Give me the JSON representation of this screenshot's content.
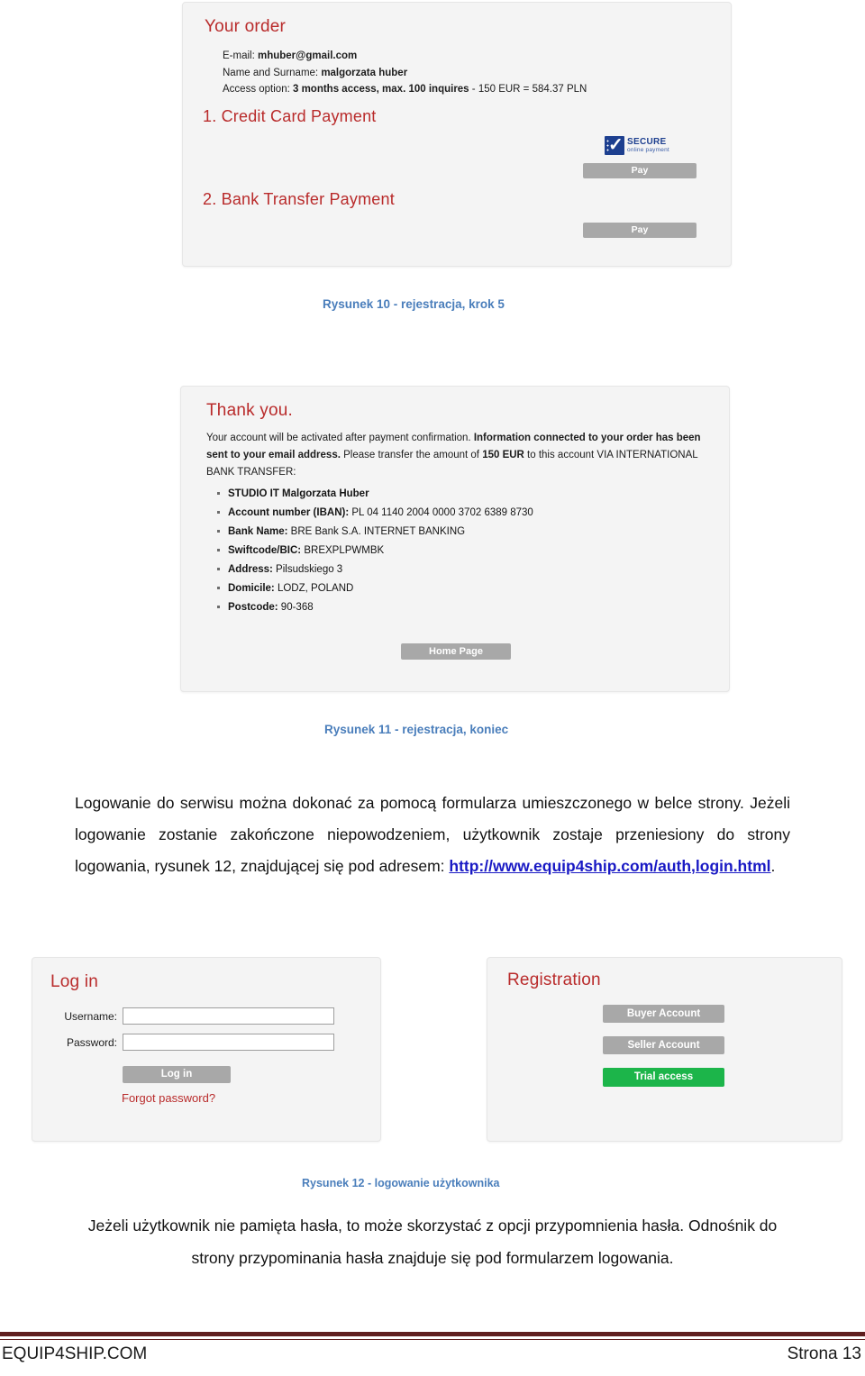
{
  "figure_order": {
    "title": "Your order",
    "details": [
      {
        "label": "E-mail: ",
        "value": "mhuber@gmail.com"
      },
      {
        "label": "Name and Surname: ",
        "value": "malgorzata huber"
      },
      {
        "label": "Access option: ",
        "value": "3 months access, max. 100 inquires",
        "suffix": " - 150 EUR = 584.37 PLN"
      }
    ],
    "credit_card_heading": "1. Credit Card Payment",
    "bank_transfer_heading": "2. Bank Transfer Payment",
    "secure_badge": {
      "line1": "SECURE",
      "line2": "online payment",
      "icon": "secure-check-icon"
    },
    "pay_button_cc": "Pay",
    "pay_button_bt": "Pay"
  },
  "figure_thanks": {
    "title": "Thank you.",
    "body_part1": "Your account will be activated after payment confirmation. ",
    "body_bold1": "Information connected to your order has been sent to your email address.",
    "body_part2": " Please transfer the amount of ",
    "body_bold2": "150 EUR",
    "body_part3": " to this account VIA INTERNATIONAL BANK TRANSFER:",
    "bank_items": [
      {
        "label": "STUDIO IT Malgorzata Huber",
        "value": ""
      },
      {
        "label": "Account number (IBAN): ",
        "value": "PL 04 1140 2004 0000 3702 6389 8730"
      },
      {
        "label": "Bank Name: ",
        "value": "BRE Bank S.A. INTERNET BANKING"
      },
      {
        "label": "Swiftcode/BIC: ",
        "value": "BREXPLPWMBK"
      },
      {
        "label": "Address: ",
        "value": "Pilsudskiego 3"
      },
      {
        "label": "Domicile: ",
        "value": "LODZ, POLAND"
      },
      {
        "label": "Postcode: ",
        "value": "90-368"
      }
    ],
    "home_button": "Home Page"
  },
  "figure_login": {
    "login_title": "Log in",
    "username_label": "Username:",
    "username_value": "",
    "password_label": "Password:",
    "password_value": "",
    "login_button": "Log in",
    "forgot_link": "Forgot password?",
    "registration_title": "Registration",
    "buyer_button": "Buyer Account",
    "seller_button": "Seller Account",
    "trial_button": "Trial access",
    "trial_color": "#1cb54a"
  },
  "captions": {
    "fig10": "Rysunek 10 - rejestracja, krok 5",
    "fig11": "Rysunek 11 - rejestracja, koniec",
    "fig12": "Rysunek 12 - logowanie użytkownika",
    "color": "#4a7ebb"
  },
  "paragraphs": {
    "p1_before_link": "Logowanie do serwisu można dokonać za pomocą formularza umieszczonego w belce strony. Jeżeli logowanie zostanie zakończone niepowodzeniem, użytkownik zostaje przeniesiony do strony logowania, rysunek 12, znajdującej się pod adresem: ",
    "p1_link": "http://www.equip4ship.com/auth,login.html",
    "p1_after_link": ".",
    "p2_line1": "Jeżeli użytkownik nie pamięta hasła, to może skorzystać z opcji przypomnienia hasła.",
    "p2_line2": "Odnośnik do strony przypominania hasła znajduje się pod formularzem logowania."
  },
  "footer": {
    "left": "EQUIP4SHIP.COM",
    "right": "Strona 13",
    "rule_color": "#5f1f1f"
  }
}
